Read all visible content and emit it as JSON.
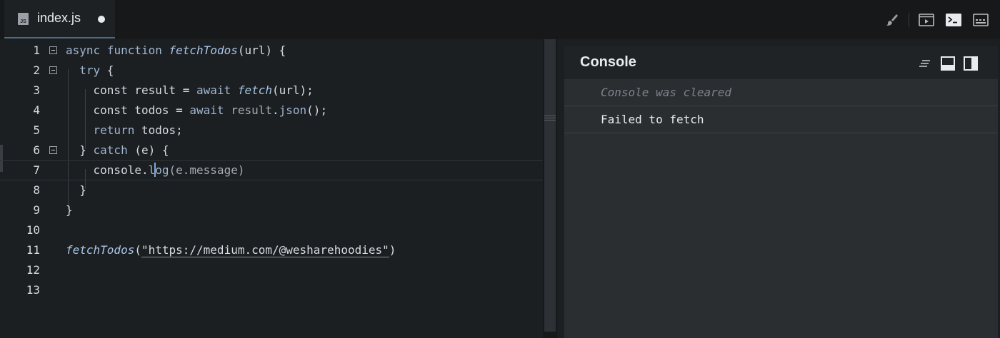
{
  "tab": {
    "icon": "js-file-icon",
    "icon_label": "JS",
    "label": "index.js",
    "modified": true
  },
  "toolbar": {
    "buttons": [
      {
        "name": "prettier-brush-icon"
      },
      {
        "name": "run-preview-icon"
      },
      {
        "name": "terminal-icon"
      },
      {
        "name": "keyboard-icon"
      }
    ]
  },
  "editor": {
    "language": "javascript",
    "current_line": 7,
    "lines": [
      {
        "n": "1",
        "text": "async function fetchTodos(url) {"
      },
      {
        "n": "2",
        "text": "  try {"
      },
      {
        "n": "3",
        "text": "    const result = await fetch(url);"
      },
      {
        "n": "4",
        "text": "    const todos = await result.json();"
      },
      {
        "n": "5",
        "text": "    return todos;"
      },
      {
        "n": "6",
        "text": "  } catch (e) {"
      },
      {
        "n": "7",
        "text": "    console.log(e.message)"
      },
      {
        "n": "8",
        "text": "  }"
      },
      {
        "n": "9",
        "text": "}"
      },
      {
        "n": "10",
        "text": ""
      },
      {
        "n": "11",
        "text": "fetchTodos(\"https://medium.com/@wesharehoodies\")"
      },
      {
        "n": "12",
        "text": ""
      },
      {
        "n": "13",
        "text": ""
      }
    ]
  },
  "console": {
    "title": "Console",
    "buttons": [
      {
        "name": "clear-console-icon"
      },
      {
        "name": "dock-bottom-icon"
      },
      {
        "name": "dock-right-icon"
      }
    ],
    "entries": [
      {
        "type": "info",
        "text": "Console was cleared"
      },
      {
        "type": "log",
        "text": "Failed to fetch"
      }
    ]
  },
  "colors": {
    "background": "#1c1f22",
    "console_background": "#2a2e31",
    "keyword": "#9fb5d0",
    "function": "#a9c4e6",
    "tab_underline": "#4b6c88"
  }
}
